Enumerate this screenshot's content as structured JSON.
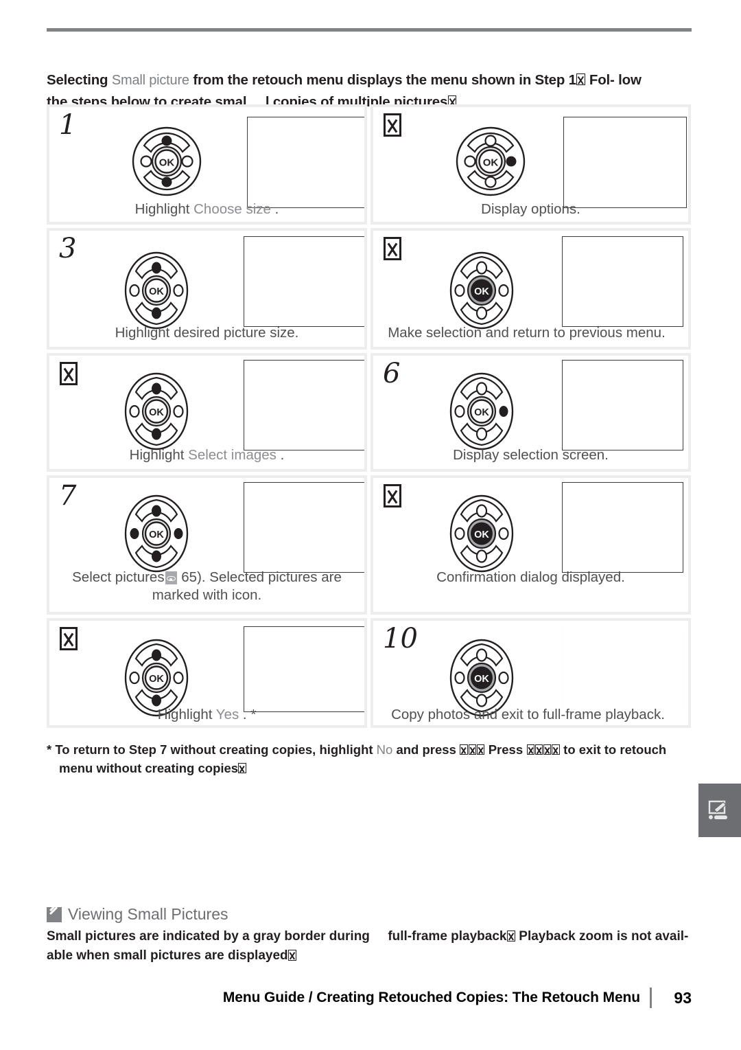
{
  "intro": {
    "before_term": "Selecting ",
    "term": "Small picture",
    "after_term": " from the retouch menu displays the menu shown in Step 1",
    "line1_end": " Fol-",
    "line2a": "low the steps below to create smal",
    "line2b": "l copies of multiple pictures"
  },
  "steps": [
    {
      "number": "1",
      "number_is_glyph_box": false,
      "caption_parts": [
        {
          "text": "Highlight ",
          "style": "dark"
        },
        {
          "text": "Choose size",
          "style": "light"
        },
        {
          "text": " .",
          "style": "dark"
        }
      ],
      "selector": {
        "shape": "round",
        "up": "filled",
        "down": "filled",
        "left": "open",
        "right": "open",
        "ok": "open"
      }
    },
    {
      "number": "2",
      "number_is_glyph_box": true,
      "caption_parts": [
        {
          "text": "Display options.",
          "style": "dark"
        }
      ],
      "selector": {
        "shape": "round",
        "up": "open",
        "down": "open",
        "left": "open",
        "right": "filled",
        "ok": "open"
      }
    },
    {
      "number": "3",
      "number_is_glyph_box": false,
      "caption_parts": [
        {
          "text": "Highlight desired picture size.",
          "style": "dark"
        }
      ],
      "selector": {
        "shape": "oval",
        "up": "filled",
        "down": "filled",
        "left": "open",
        "right": "open",
        "ok": "open"
      }
    },
    {
      "number": "4",
      "number_is_glyph_box": true,
      "caption_parts": [
        {
          "text": "Make selection and return to previous menu.",
          "style": "dark"
        }
      ],
      "selector": {
        "shape": "oval",
        "up": "open",
        "down": "open",
        "left": "open",
        "right": "open",
        "ok": "filled"
      }
    },
    {
      "number": "5",
      "number_is_glyph_box": true,
      "caption_parts": [
        {
          "text": "Highlight ",
          "style": "dark"
        },
        {
          "text": "Select images",
          "style": "light"
        },
        {
          "text": " .",
          "style": "dark"
        }
      ],
      "selector": {
        "shape": "oval",
        "up": "filled",
        "down": "filled",
        "left": "open",
        "right": "open",
        "ok": "open"
      }
    },
    {
      "number": "6",
      "number_is_glyph_box": false,
      "caption_parts": [
        {
          "text": "Display selection screen.",
          "style": "dark"
        }
      ],
      "selector": {
        "shape": "oval",
        "up": "open",
        "down": "open",
        "left": "open",
        "right": "filled",
        "ok": "open"
      }
    },
    {
      "number": "7",
      "number_is_glyph_box": false,
      "caption_line1_a": "Select pictures",
      "caption_line1_icon": "view-icon",
      "caption_line1_b": " 65).  Selected pictures are",
      "caption_line2": "marked with     icon.",
      "caption_parts": [],
      "selector": {
        "shape": "oval",
        "up": "filled",
        "down": "filled",
        "left": "filled",
        "right": "filled",
        "ok": "open"
      }
    },
    {
      "number": "8",
      "number_is_glyph_box": true,
      "caption_parts": [
        {
          "text": "Confirmation dialog displayed.",
          "style": "dark"
        }
      ],
      "selector": {
        "shape": "oval",
        "up": "open",
        "down": "open",
        "left": "open",
        "right": "open",
        "ok": "filled"
      }
    },
    {
      "number": "9",
      "number_is_glyph_box": true,
      "caption_parts": [
        {
          "text": "Highlight ",
          "style": "dark"
        },
        {
          "text": "Yes",
          "style": "light"
        },
        {
          "text": " . *",
          "style": "dark"
        }
      ],
      "selector": {
        "shape": "oval",
        "up": "filled",
        "down": "filled",
        "left": "open",
        "right": "open",
        "ok": "open"
      }
    },
    {
      "number": "10",
      "number_is_glyph_box": false,
      "caption_parts": [
        {
          "text": "Copy photos and exit to full-frame playback.",
          "style": "dark"
        }
      ],
      "selector": {
        "shape": "oval",
        "up": "open",
        "down": "open",
        "left": "open",
        "right": "open",
        "ok": "filled"
      }
    }
  ],
  "footnote": {
    "line1_a": "* To return to Step 7 without creating copies, highlight ",
    "line1_term": "No",
    "line1_b": " and press ",
    "line1_c": "  Press ",
    "line1_d": " to exit to retouch",
    "line2": "menu without creating copies"
  },
  "note": {
    "heading": "Viewing Small Pictures",
    "body_a": "Small pictures are indicated by a gray border during ",
    "body_b": "full-frame playback",
    "body_c": " Playback zoom is not avail-",
    "body_d": "able when small pictures are displayed"
  },
  "footer": {
    "title": "Menu Guide / Creating Retouched Copies: The Retouch Menu",
    "page": "93"
  },
  "colors": {
    "rule": "#808285",
    "box_border": "#ededee",
    "caption_dark": "#4f5052",
    "caption_light": "#8b8d90",
    "side_tab": "#6d6e71"
  }
}
